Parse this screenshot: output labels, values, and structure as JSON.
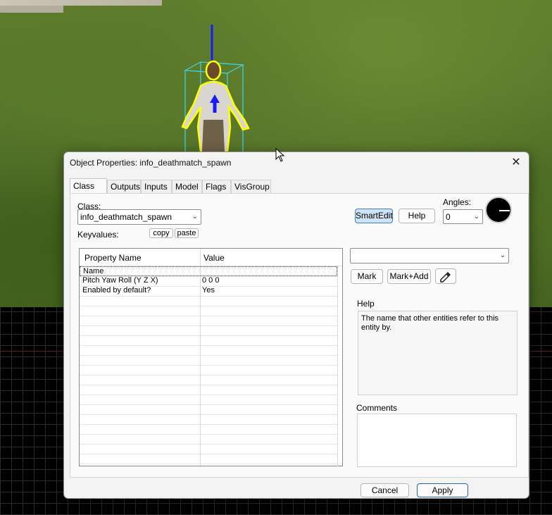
{
  "dialog": {
    "title": "Object Properties: info_deathmatch_spawn",
    "close_glyph": "✕"
  },
  "tabs": [
    "Class Info",
    "Outputs",
    "Inputs",
    "Model",
    "Flags",
    "VisGroup"
  ],
  "active_tab": "Class Info",
  "class_info": {
    "class_label": "Class:",
    "class_value": "info_deathmatch_spawn",
    "keyvalues_label": "Keyvalues:",
    "copy_label": "copy",
    "paste_label": "paste",
    "smartedit_label": "SmartEdit",
    "help_button_label": "Help",
    "angles_label": "Angles:",
    "angles_value": "0"
  },
  "property_table": {
    "columns": [
      "Property Name",
      "Value"
    ],
    "rows": [
      {
        "name": "Name",
        "value": ""
      },
      {
        "name": "Pitch Yaw Roll (Y Z X)",
        "value": "0 0 0"
      },
      {
        "name": "Enabled by default?",
        "value": "Yes"
      }
    ]
  },
  "right_panel": {
    "combo_value": "",
    "mark_label": "Mark",
    "mark_add_label": "Mark+Add",
    "eyedropper_icon": "eyedropper-icon",
    "help_label": "Help",
    "help_text": "The name that other entities refer to this entity by.",
    "comments_label": "Comments",
    "comments_value": ""
  },
  "footer": {
    "cancel_label": "Cancel",
    "apply_label": "Apply"
  },
  "colors": {
    "selection_outline": "#ffff00",
    "bounding_box": "#3fd7e6",
    "axis": "#1a1aff",
    "accent": "#3b7fc4"
  }
}
